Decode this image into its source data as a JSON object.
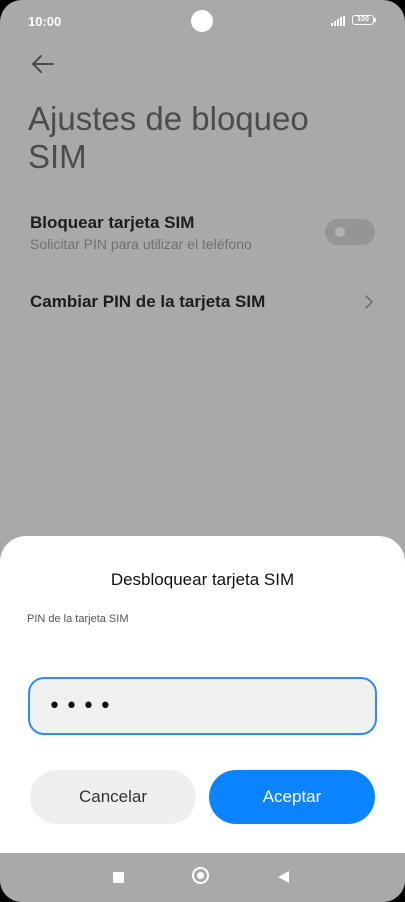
{
  "status_bar": {
    "time": "10:00",
    "battery": "100"
  },
  "header": {
    "back_icon": "arrow-left-icon",
    "title": "Ajustes de bloqueo SIM"
  },
  "settings": {
    "lock_sim": {
      "title": "Bloquear tarjeta SIM",
      "subtitle": "Solicitar PIN para utilizar el teléfono",
      "toggle_on": false
    },
    "change_pin": {
      "title": "Cambiar PIN de la tarjeta SIM",
      "icon": "chevron-right-icon"
    }
  },
  "dialog": {
    "title": "Desbloquear tarjeta SIM",
    "field_label": "PIN de la tarjeta SIM",
    "pin_value": "••••",
    "cancel_label": "Cancelar",
    "accept_label": "Aceptar"
  },
  "colors": {
    "accent": "#0d84ff",
    "dim_background": "#a9a9a9"
  },
  "navbar": {
    "icons": [
      "recents-square-icon",
      "home-circle-icon",
      "back-triangle-icon"
    ]
  }
}
